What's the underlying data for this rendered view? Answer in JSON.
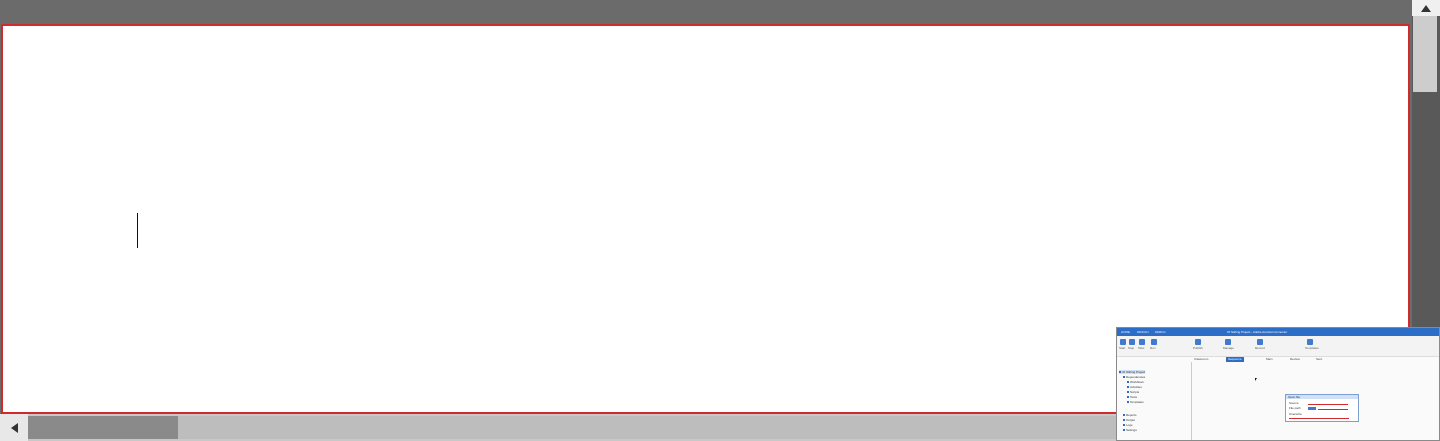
{
  "document": {
    "editable": true
  },
  "scrollbars": {
    "vertical": {
      "position": 0.04
    },
    "horizontal": {
      "position": 0.0
    }
  },
  "thumbnail_app": {
    "window_title": "IO Stirling Project - Adobe Acrobat Connector",
    "menu_tabs": [
      "HOME",
      "DESIGN",
      "DEBUG"
    ],
    "ribbon_labels": [
      "Start",
      "Stop",
      "Tabs",
      "Run",
      "Publish",
      "Manage",
      "Record",
      "Templates"
    ],
    "doc_tabs": [
      "Classroom",
      "Sequence",
      "Main",
      "Review",
      "Sent"
    ],
    "tree_items": [
      "IO Stirling Project",
      "Dependencies",
      "Workflows",
      "Activities",
      "Scripts",
      "Tests",
      "Templates",
      "Reports",
      "Output",
      "Logs",
      "Settings"
    ],
    "dialog": {
      "title": "Open file",
      "labels": [
        "Source",
        "File path",
        "Overwrite"
      ]
    }
  }
}
